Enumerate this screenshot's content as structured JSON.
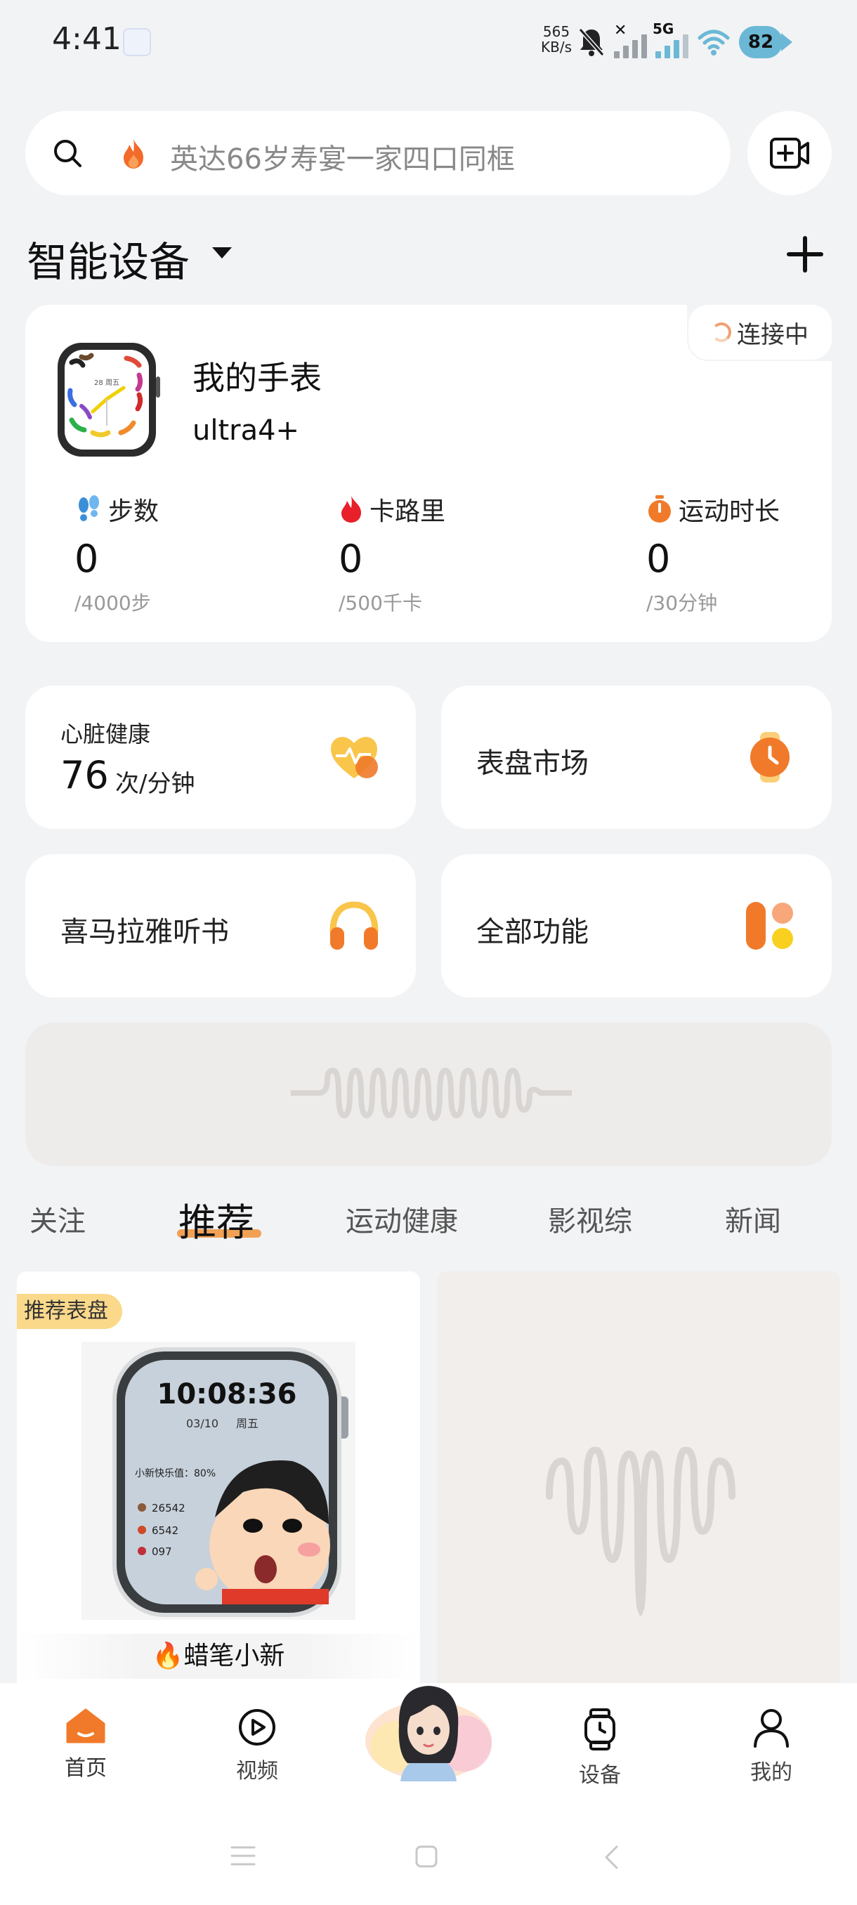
{
  "status_bar": {
    "time": "4:41",
    "net_speed_value": "565",
    "net_speed_unit": "KB/s",
    "network_type": "5G",
    "battery": "82"
  },
  "search": {
    "placeholder": "英达66岁寿宴一家四口同框"
  },
  "devices": {
    "section_title": "智能设备",
    "device": {
      "name": "我的手表",
      "model": "ultra4+",
      "connection_status": "连接中"
    },
    "stats": [
      {
        "label": "步数",
        "value": "0",
        "goal": "/4000步",
        "icon": "footprints-icon"
      },
      {
        "label": "卡路里",
        "value": "0",
        "goal": "/500千卡",
        "icon": "flame-icon"
      },
      {
        "label": "运动时长",
        "value": "0",
        "goal": "/30分钟",
        "icon": "stopwatch-icon"
      }
    ]
  },
  "quick_actions": {
    "heart": {
      "title": "心脏健康",
      "value": "76",
      "unit": "次/分钟"
    },
    "watch_face_market": "表盘市场",
    "audiobook": "喜马拉雅听书",
    "all_functions": "全部功能"
  },
  "tabs": [
    "关注",
    "推荐",
    "运动健康",
    "影视综",
    "新闻"
  ],
  "active_tab": "推荐",
  "feed": {
    "badge": "推荐表盘",
    "caption": "蜡笔小新",
    "watch_face": {
      "time": "10:08:36",
      "date": "03/10",
      "weekday": "周五",
      "happiness": "小新快乐值：80%",
      "steps": "26542",
      "calories": "6542",
      "heart": "097"
    }
  },
  "device_watch_face": {
    "date": "28",
    "weekday": "周五"
  },
  "bottom_nav": [
    {
      "label": "首页",
      "icon": "home-icon"
    },
    {
      "label": "视频",
      "icon": "play-icon"
    },
    {
      "label": "",
      "icon": "assistant-avatar"
    },
    {
      "label": "设备",
      "icon": "watch-icon"
    },
    {
      "label": "我的",
      "icon": "person-icon"
    }
  ],
  "colors": {
    "accent_orange": "#f0923a",
    "background": "#f2f3f5",
    "card": "#ffffff"
  }
}
